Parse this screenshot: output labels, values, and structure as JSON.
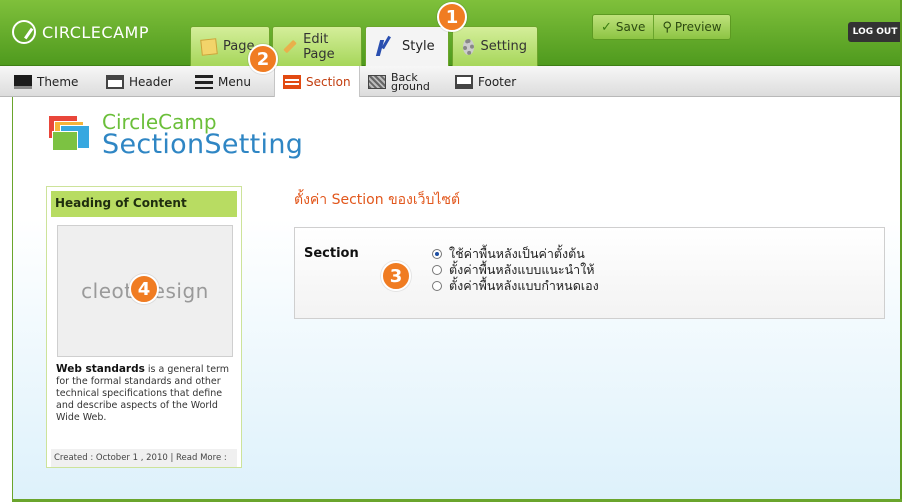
{
  "brand": {
    "name": "CIRCLECAMP"
  },
  "main_tabs": [
    {
      "label": "Page",
      "icon": "page-icon"
    },
    {
      "label": "Edit Page",
      "icon": "pencil-icon"
    },
    {
      "label": "Style",
      "icon": "style-icon",
      "active": true
    },
    {
      "label": "Setting",
      "icon": "gear-icon"
    }
  ],
  "actions": {
    "save": "Save",
    "preview": "Preview"
  },
  "logout": "LOG OUT",
  "sub_tabs": [
    {
      "label": "Theme"
    },
    {
      "label": "Header"
    },
    {
      "label": "Menu"
    },
    {
      "label": "Section",
      "active": true
    },
    {
      "label_line1": "Back",
      "label_line2": "ground"
    },
    {
      "label": "Footer"
    }
  ],
  "page_heading": {
    "line1": "CircleCamp",
    "line2": "SectionSetting"
  },
  "preview_card": {
    "heading": "Heading of Content",
    "image_text": "cleot design",
    "body_bold": "Web standards",
    "body_text": " is a general term for the formal standards and other technical specifications that define and describe aspects of the World Wide Web.",
    "footer": "Created : October 1 , 2010 | Read More :"
  },
  "section_title": "ตั้งค่า Section ของเว็บไซต์",
  "section_panel": {
    "label": "Section",
    "options": [
      {
        "label": "ใช้ค่าพื้นหลังเป็นค่าตั้งต้น",
        "selected": true
      },
      {
        "label": "ตั้งค่าพื้นหลังแบบแนะนำให้",
        "selected": false
      },
      {
        "label": "ตั้งค่าพื้นหลังแบบกำหนดเอง",
        "selected": false
      }
    ]
  },
  "markers": [
    "1",
    "2",
    "3",
    "4"
  ],
  "colors": {
    "brand_green": "#5ea82a",
    "accent_orange": "#f07c22",
    "heading_blue": "#2f86c4"
  }
}
